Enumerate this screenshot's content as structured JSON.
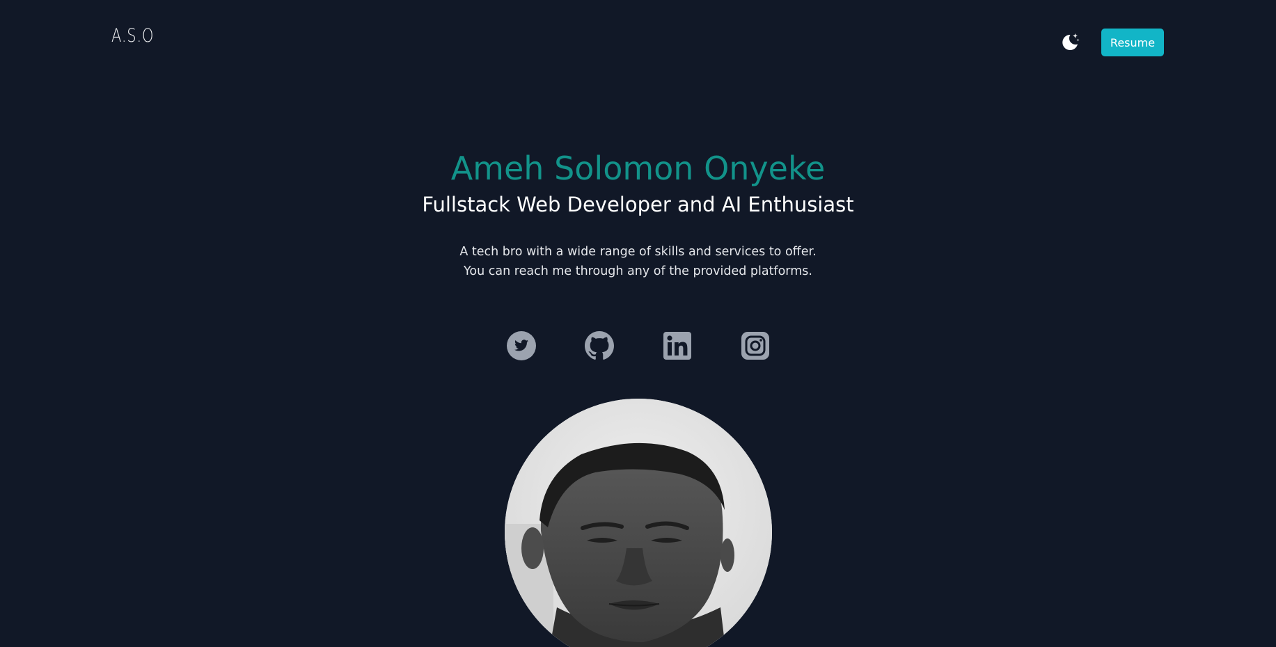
{
  "header": {
    "logo_text": "A.S.O",
    "theme_toggle_icon": "moon-sparkle-icon",
    "resume_label": "Resume",
    "resume_color": "#12b5c7"
  },
  "hero": {
    "name": "Ameh Solomon Onyeke",
    "name_color": "#12938a",
    "title": "Fullstack Web Developer and AI Enthusiast",
    "description": "A tech bro with a wide range of skills and services to offer. You can reach me through any of the provided platforms."
  },
  "socials": [
    {
      "icon": "twitter-icon"
    },
    {
      "icon": "github-icon"
    },
    {
      "icon": "linkedin-icon"
    },
    {
      "icon": "instagram-icon"
    }
  ],
  "colors": {
    "background": "#111827",
    "icon_gray": "#9ca3af"
  }
}
